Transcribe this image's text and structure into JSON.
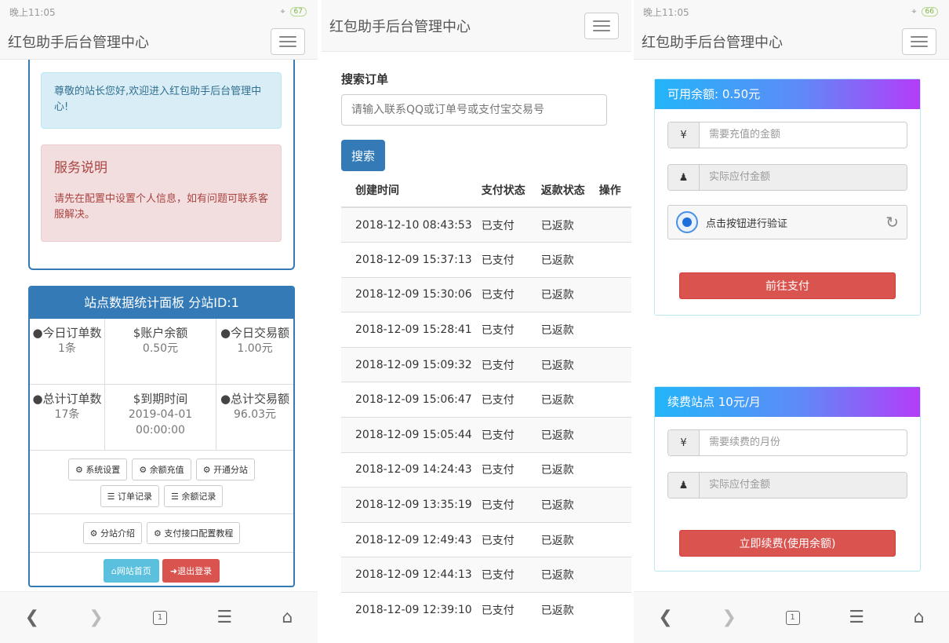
{
  "status_time": "晚上11:05",
  "battery_1": "67",
  "battery_3": "66",
  "brand": "红包助手后台管理中心",
  "p1": {
    "welcome": "尊敬的站长您好,欢迎进入红包助手后台管理中心!",
    "service_title": "服务说明",
    "service_text": "请先在配置中设置个人信息，如有问题可联系客服解决。",
    "panel_title": "站点数据统计面板 分站ID:1",
    "stats": [
      {
        "icon": "drop-icon",
        "label": "今日订单数",
        "value": "1条"
      },
      {
        "icon": "dollar-icon",
        "label": "账户余额",
        "value": "0.50元"
      },
      {
        "icon": "drop-icon",
        "label": "今日交易额",
        "value": "1.00元"
      },
      {
        "icon": "drop-icon",
        "label": "总计订单数",
        "value": "17条"
      },
      {
        "icon": "dollar-icon",
        "label": "到期时间",
        "value": "2019-04-01 00:00:00"
      },
      {
        "icon": "drop-icon",
        "label": "总计交易额",
        "value": "96.03元"
      }
    ],
    "buttons": {
      "system_settings": "系统设置",
      "balance_recharge": "余额充值",
      "open_substation": "开通分站",
      "order_records": "订单记录",
      "balance_records": "余额记录",
      "substation_intro": "分站介绍",
      "payment_tutorial": "支付接口配置教程",
      "home": "网站首页",
      "logout": "退出登录"
    }
  },
  "p2": {
    "search_label": "搜索订单",
    "search_placeholder": "请输入联系QQ或订单号或支付宝交易号",
    "search_button": "搜索",
    "columns": [
      "创建时间",
      "支付状态",
      "返款状态",
      "操作"
    ],
    "rows": [
      [
        "2018-12-10 08:43:53",
        "已支付",
        "已返款"
      ],
      [
        "2018-12-09 15:37:13",
        "已支付",
        "已返款"
      ],
      [
        "2018-12-09 15:30:06",
        "已支付",
        "已返款"
      ],
      [
        "2018-12-09 15:28:41",
        "已支付",
        "已返款"
      ],
      [
        "2018-12-09 15:09:32",
        "已支付",
        "已返款"
      ],
      [
        "2018-12-09 15:06:47",
        "已支付",
        "已返款"
      ],
      [
        "2018-12-09 15:05:44",
        "已支付",
        "已返款"
      ],
      [
        "2018-12-09 14:24:43",
        "已支付",
        "已返款"
      ],
      [
        "2018-12-09 13:35:19",
        "已支付",
        "已返款"
      ],
      [
        "2018-12-09 12:49:43",
        "已支付",
        "已返款"
      ],
      [
        "2018-12-09 12:44:13",
        "已支付",
        "已返款"
      ],
      [
        "2018-12-09 12:39:10",
        "已支付",
        "已返款"
      ]
    ]
  },
  "p3": {
    "recharge": {
      "title": "可用余额: 0.50元",
      "amount_placeholder": "需要充值的金额",
      "pay_placeholder": "实际应付金额",
      "captcha_text": "点击按钮进行验证",
      "button": "前往支付"
    },
    "renew": {
      "title": "续费站点 10元/月",
      "months_placeholder": "需要续费的月份",
      "pay_placeholder": "实际应付金额",
      "button": "立即续费(使用余额)"
    }
  },
  "bottom_nav": {
    "tab_count": "1"
  },
  "colors": {
    "primary": "#337ab7",
    "danger": "#d9534f",
    "info": "#5bc0de"
  }
}
